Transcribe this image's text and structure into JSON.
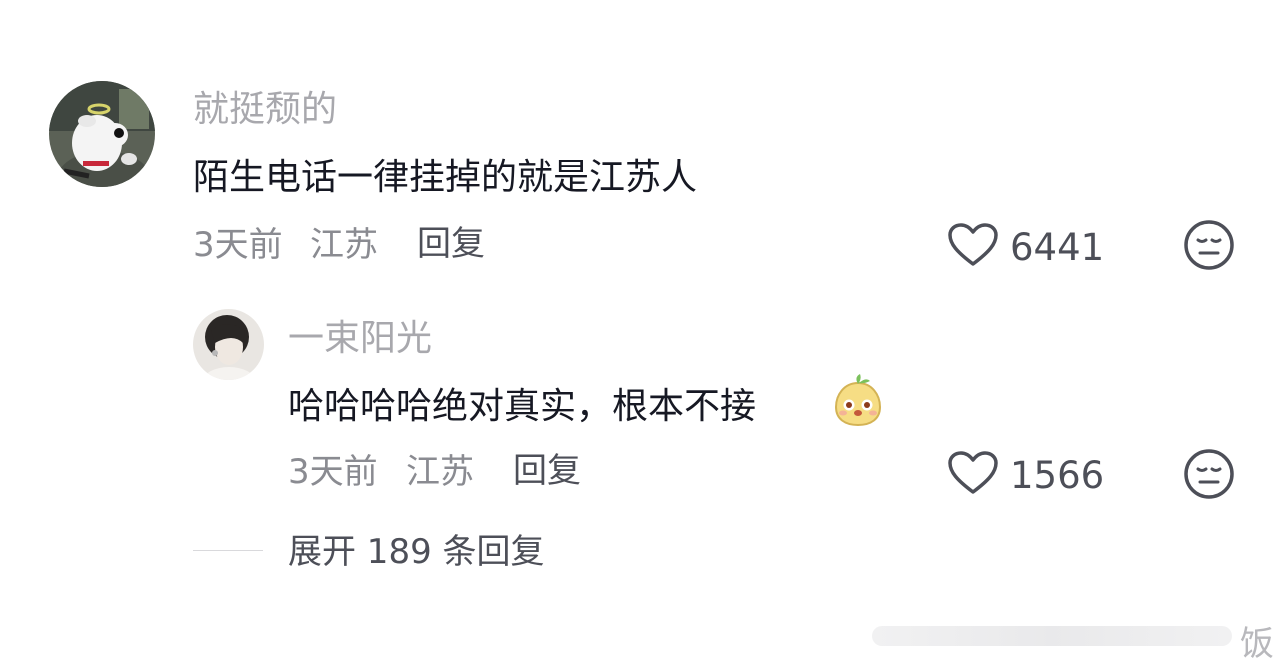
{
  "comments": [
    {
      "username": "就挺颓的",
      "text": "陌生电话一律挂掉的就是江苏人",
      "time": "3天前",
      "location": "江苏",
      "reply_label": "回复",
      "likes": "6441",
      "avatar_icon": "cartoon-dog-avatar"
    }
  ],
  "replies": [
    {
      "username": "一束阳光",
      "text": "哈哈哈哈绝对真实，根本不接",
      "time": "3天前",
      "location": "江苏",
      "reply_label": "回复",
      "likes": "1566",
      "avatar_icon": "person-photo-avatar",
      "emoji_icon": "cute-bun-emoji"
    }
  ],
  "expand_label": "展开 189 条回复",
  "watermark": "饭",
  "colors": {
    "username": "#a8a8ad",
    "text": "#161823",
    "meta": "#8a8b91",
    "action": "#4d4f58"
  }
}
